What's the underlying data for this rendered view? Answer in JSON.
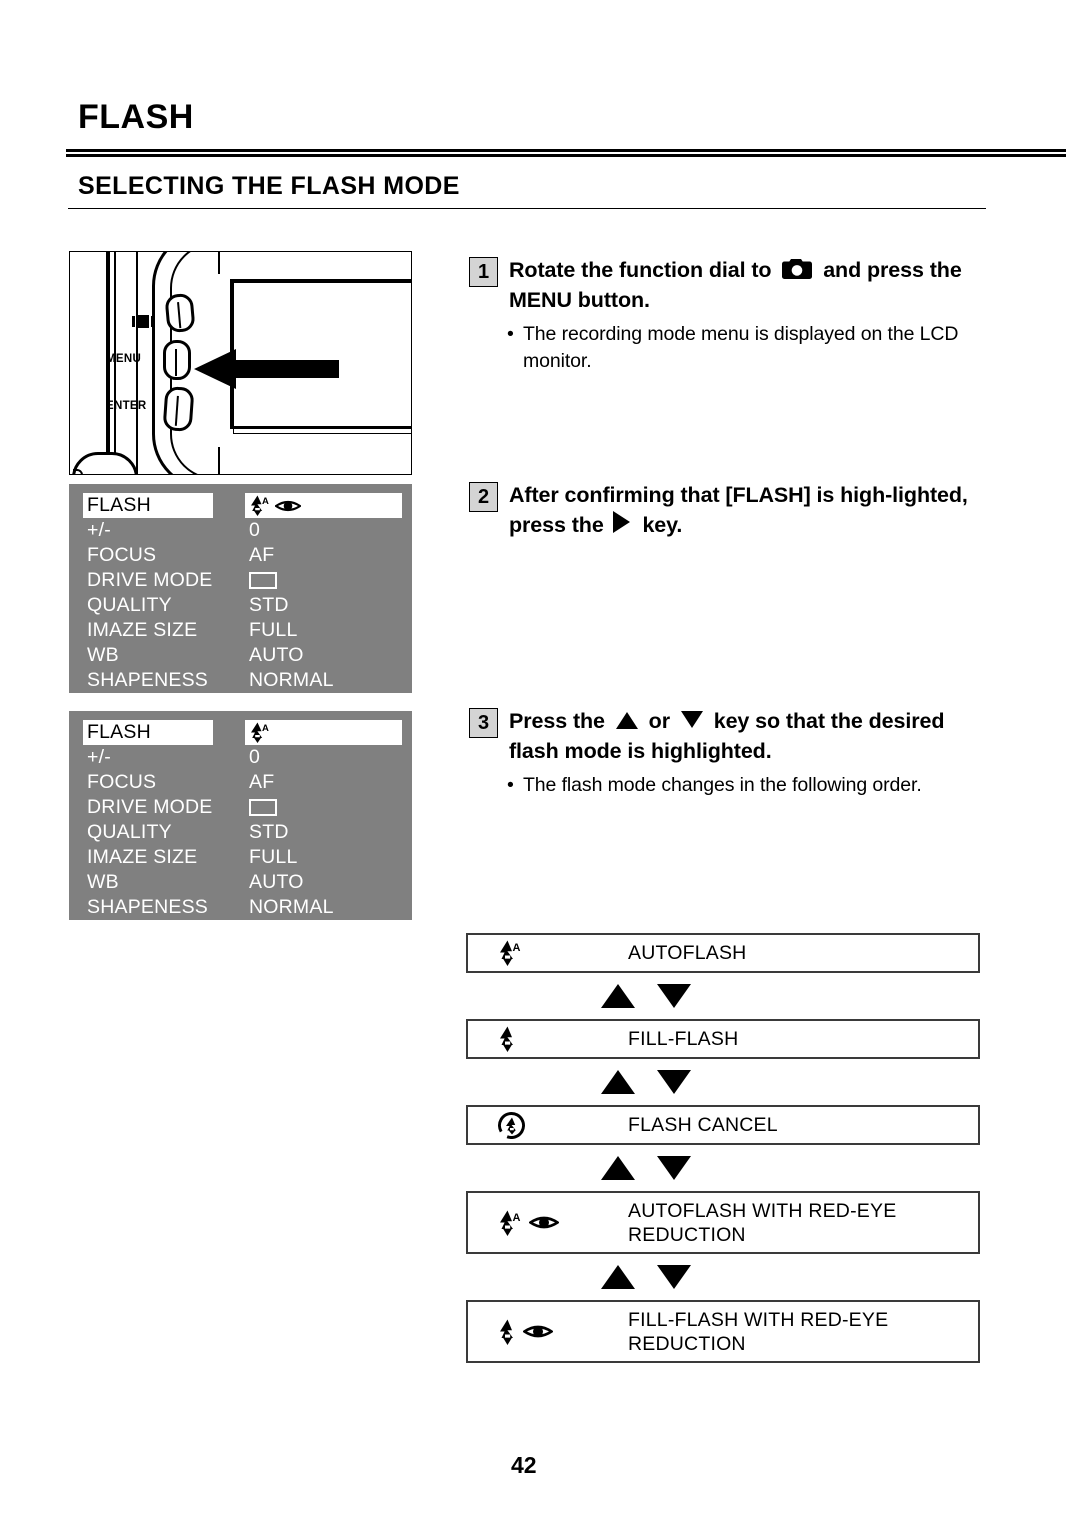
{
  "document": {
    "chapter_title": "FLASH",
    "section_title": "SELECTING THE FLASH MODE",
    "page_number": "42"
  },
  "camera_figure": {
    "labels": {
      "menu": "MENU",
      "enter": "ENTER"
    },
    "icons": {
      "display": "display-icon",
      "arrow": "left-arrow-pointer"
    }
  },
  "lcd_menus": [
    {
      "name": "recording-mode-menu-autoflash-redeye",
      "rows": [
        {
          "label": "FLASH",
          "value": "",
          "value_icons": [
            "flash-auto-icon",
            "red-eye-icon"
          ],
          "highlighted": true
        },
        {
          "label": "+/-",
          "value": "0"
        },
        {
          "label": "FOCUS",
          "value": "AF"
        },
        {
          "label": "DRIVE MODE",
          "value": "",
          "value_icon": "single-frame-icon"
        },
        {
          "label": "QUALITY",
          "value": "STD"
        },
        {
          "label": "IMAZE SIZE",
          "value": "FULL"
        },
        {
          "label": "WB",
          "value": "AUTO"
        },
        {
          "label": "SHAPENESS",
          "value": "NORMAL"
        }
      ]
    },
    {
      "name": "recording-mode-menu-autoflash",
      "rows": [
        {
          "label": "FLASH",
          "value": "",
          "value_icons": [
            "flash-auto-icon"
          ],
          "highlighted": true
        },
        {
          "label": "+/-",
          "value": "0"
        },
        {
          "label": "FOCUS",
          "value": "AF"
        },
        {
          "label": "DRIVE MODE",
          "value": "",
          "value_icon": "single-frame-icon"
        },
        {
          "label": "QUALITY",
          "value": "STD"
        },
        {
          "label": "IMAZE SIZE",
          "value": "FULL"
        },
        {
          "label": "WB",
          "value": "AUTO"
        },
        {
          "label": "SHAPENESS",
          "value": "NORMAL"
        }
      ]
    }
  ],
  "steps": [
    {
      "number": "1",
      "text_before_icon": "Rotate the function dial to",
      "icon": "camera-icon",
      "text_after_icon": "and press the MENU button.",
      "bullet": "The recording mode menu is displayed on the LCD monitor."
    },
    {
      "number": "2",
      "text_before_icon": "After confirming that [FLASH] is high-lighted, press the",
      "icon": "triangle-right-icon",
      "text_after_icon": "key.",
      "bullet": ""
    },
    {
      "number": "3",
      "text_before_icon": "Press the",
      "icon": "triangle-up-icon",
      "text_mid": "or",
      "icon2": "triangle-down-icon",
      "text_after_icon": "key so that the desired flash mode is highlighted.",
      "bullet": "The flash mode changes in the following order."
    }
  ],
  "flash_modes": [
    {
      "icons": [
        "flash-auto-icon"
      ],
      "label": "AUTOFLASH",
      "two_line": false
    },
    {
      "icons": [
        "flash-fill-icon"
      ],
      "label": "FILL-FLASH",
      "two_line": false
    },
    {
      "icons": [
        "flash-cancel-icon"
      ],
      "label": "FLASH CANCEL",
      "two_line": false
    },
    {
      "icons": [
        "flash-auto-icon",
        "red-eye-icon"
      ],
      "label": "AUTOFLASH WITH RED-EYE\nREDUCTION",
      "two_line": true
    },
    {
      "icons": [
        "flash-fill-icon",
        "red-eye-icon"
      ],
      "label": "FILL-FLASH WITH RED-EYE\nREDUCTION",
      "two_line": true
    }
  ],
  "colors": {
    "lcd_background": "#808080",
    "lcd_text": "#ffffff",
    "highlight_background": "#ffffff",
    "highlight_text": "#000000",
    "step_badge_background": "#d4d4d4",
    "ink": "#000000"
  }
}
